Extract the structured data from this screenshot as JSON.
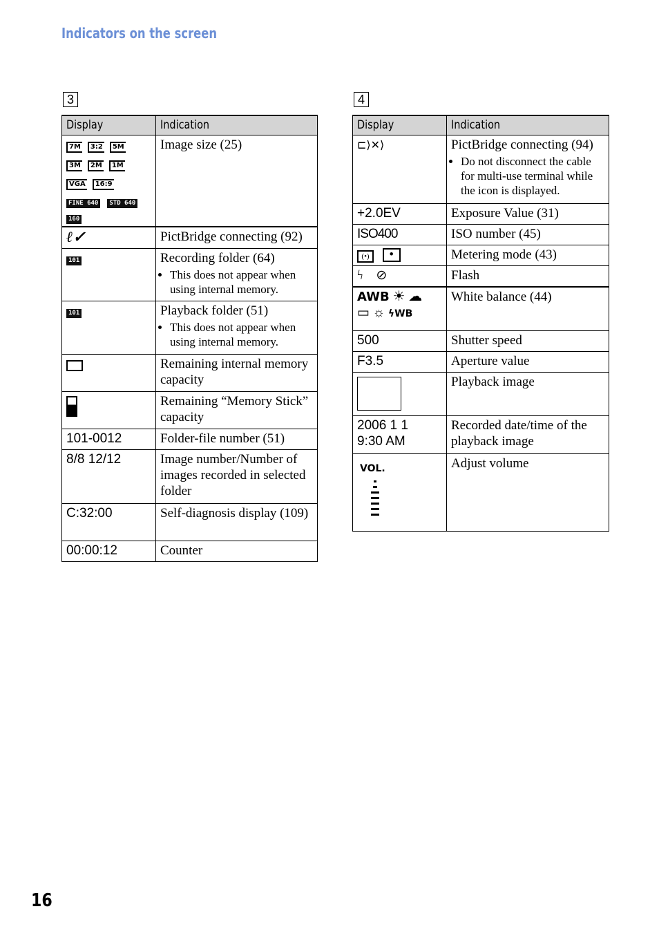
{
  "title": "Indicators on the screen",
  "page_number": "16",
  "section3": {
    "number": "3",
    "headers": {
      "display": "Display",
      "indication": "Indication"
    },
    "image_size_icons": [
      "7M",
      "3:2",
      "5M",
      "3M",
      "2M",
      "1M",
      "VGA",
      "16:9"
    ],
    "quality_icons": [
      "FINE 640",
      "STD 640",
      "160"
    ],
    "rows": [
      {
        "indication": "Image size (25)"
      },
      {
        "display_icon": "pictbridge-icon",
        "indication": "PictBridge connecting (92)"
      },
      {
        "display_icon": "101",
        "indication": "Recording folder (64)",
        "note": "This does not appear when using internal memory."
      },
      {
        "display_icon": "101",
        "indication": "Playback folder (51)",
        "note": "This does not appear when using internal memory."
      },
      {
        "display_icon": "internal-memory-icon",
        "indication": "Remaining internal memory capacity"
      },
      {
        "display_icon": "memory-stick-icon",
        "indication": "Remaining “Memory Stick” capacity"
      },
      {
        "display": "101-0012",
        "indication": "Folder-file number (51)"
      },
      {
        "display": "8/8 12/12",
        "indication": "Image number/Number of images recorded in selected folder"
      },
      {
        "display": "C:32:00",
        "indication": "Self-diagnosis display (109)"
      },
      {
        "display": "00:00:12",
        "indication": "Counter"
      }
    ]
  },
  "section4": {
    "number": "4",
    "headers": {
      "display": "Display",
      "indication": "Indication"
    },
    "rows": [
      {
        "display_icon": "pictbridge-disconnect-icon",
        "indication": "PictBridge connecting (94)",
        "note": "Do not disconnect the cable for multi-use terminal while the icon is displayed."
      },
      {
        "display": "+2.0EV",
        "indication": "Exposure Value (31)"
      },
      {
        "display": "ISO400",
        "indication": "ISO number (45)"
      },
      {
        "display_icon": "metering-icons",
        "indication": "Metering mode (43)"
      },
      {
        "display_icon": "flash-icons",
        "indication": "Flash"
      },
      {
        "display": "AWB",
        "wb_flash": "WB",
        "indication": "White balance (44)"
      },
      {
        "display": "500",
        "indication": "Shutter speed"
      },
      {
        "display": "F3.5",
        "indication": "Aperture value"
      },
      {
        "display_icon": "playback-image",
        "indication": "Playback image"
      },
      {
        "display_line1": "2006 1 1",
        "display_line2": "9:30 AM",
        "indication": "Recorded date/time of the playback image"
      },
      {
        "display": "VOL.",
        "indication": "Adjust volume"
      }
    ]
  }
}
